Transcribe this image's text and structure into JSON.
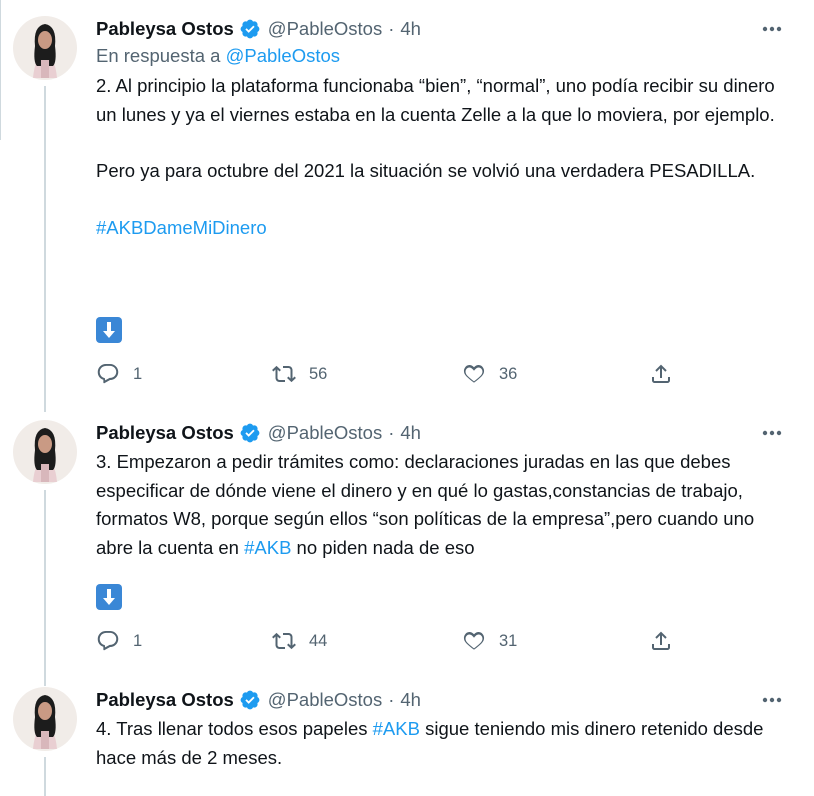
{
  "tweets": [
    {
      "name": "Pableysa Ostos",
      "handle": "@PableOstos",
      "separator": "·",
      "time": "4h",
      "reply_prefix": "En respuesta a",
      "reply_handle": "@PableOstos",
      "paragraphs": [
        "2. Al principio la plataforma funcionaba “bien”, “normal”, uno podía recibir su dinero un lunes y ya el viernes estaba en la cuenta Zelle a la que lo moviera, por ejemplo.",
        "Pero ya para octubre del 2021 la situación se volvió una verdadera PESADILLA."
      ],
      "hashtag": "#AKBDameMiDinero",
      "replies": "1",
      "retweets": "56",
      "likes": "36"
    },
    {
      "name": "Pableysa Ostos",
      "handle": "@PableOstos",
      "separator": "·",
      "time": "4h",
      "text_before": "3. Empezaron a pedir trámites como: declaraciones juradas en las que debes especificar de dónde viene el dinero y en qué lo gastas,constancias de trabajo, formatos W8, porque según ellos “son políticas de la empresa”,pero cuando uno abre la cuenta en ",
      "text_hashtag": "#AKB",
      "text_after": " no piden nada de eso",
      "replies": "1",
      "retweets": "44",
      "likes": "31"
    },
    {
      "name": "Pableysa Ostos",
      "handle": "@PableOstos",
      "separator": "·",
      "time": "4h",
      "text_before": "4. Tras llenar todos esos papeles ",
      "text_hashtag": "#AKB",
      "text_after": " sigue teniendo mis dinero retenido desde hace más de 2 meses."
    }
  ],
  "colors": {
    "text": "#0f1419",
    "secondary": "#536471",
    "link": "#1d9bf0",
    "thread_line": "#cfd9de",
    "emoji_bg": "#3a87d6"
  },
  "icons": [
    "verified-badge-icon",
    "more-options-icon",
    "down-arrow-emoji-icon",
    "reply-icon",
    "retweet-icon",
    "like-icon",
    "share-icon"
  ]
}
